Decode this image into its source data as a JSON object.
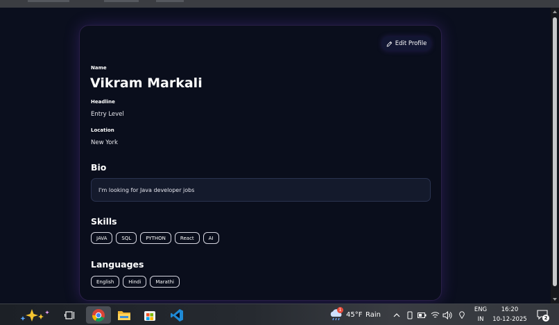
{
  "profile": {
    "edit_label": "Edit Profile",
    "name_label": "Name",
    "name": "Vikram Markali",
    "headline_label": "Headline",
    "headline": "Entry Level",
    "location_label": "Location",
    "location": "New York",
    "bio_title": "Bio",
    "bio": "I'm looking for Java developer jobs",
    "skills_title": "Skills",
    "skills": [
      "JAVA",
      "SQL",
      "PYTHON",
      "React",
      "AI"
    ],
    "languages_title": "Languages",
    "languages": [
      "English",
      "Hindi",
      "Marathi"
    ]
  },
  "taskbar": {
    "weather_temp": "45°F",
    "weather_desc": "Rain",
    "weather_badge": "1",
    "lang_top": "ENG",
    "lang_bottom": "IN",
    "time": "16:20",
    "date": "10-12-2025",
    "notification_count": "2"
  },
  "colors": {
    "background": "#0b0f1e",
    "card_glow": "#6e3cc8",
    "bio_box": "#141a2c",
    "chip_border": "#d6d6e0"
  },
  "icons": {
    "edit": "pencil-icon",
    "copilot": "sparkle-icon",
    "task_view": "task-view-icon",
    "chrome": "chrome-icon",
    "explorer": "folder-icon",
    "store": "store-icon",
    "vscode": "vscode-icon",
    "weather": "rain-cloud-icon"
  }
}
